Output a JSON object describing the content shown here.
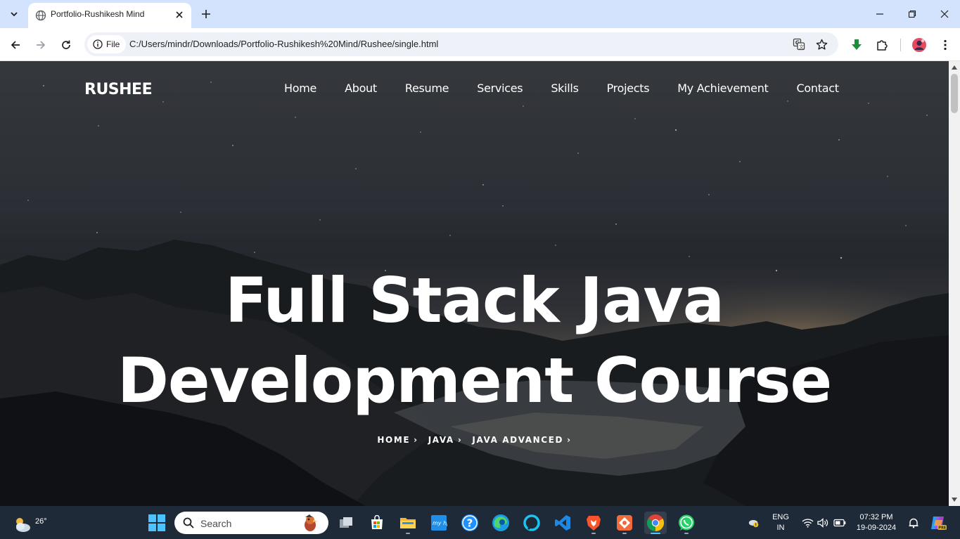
{
  "browser": {
    "tab_title": "Portfolio-Rushikesh Mind",
    "site_chip": "File",
    "url": "C:/Users/mindr/Downloads/Portfolio-Rushikesh%20Mind/Rushee/single.html"
  },
  "page": {
    "brand": "RUSHEE",
    "nav": [
      "Home",
      "About",
      "Resume",
      "Services",
      "Skills",
      "Projects",
      "My Achievement",
      "Contact"
    ],
    "hero_title_line1": "Full Stack Java",
    "hero_title_line2": "Development Course",
    "breadcrumbs": [
      "HOME",
      "JAVA",
      "JAVA ADVANCED"
    ]
  },
  "taskbar": {
    "weather_temp": "26°",
    "search_label": "Search",
    "lang_line1": "ENG",
    "lang_line2": "IN",
    "time": "07:32 PM",
    "date": "19-09-2024"
  },
  "colors": {
    "tab_strip": "#d3e3fd",
    "taskbar": "#1f2a38",
    "hero_text": "#ffffff",
    "download_arrow": "#1e8e3e"
  }
}
